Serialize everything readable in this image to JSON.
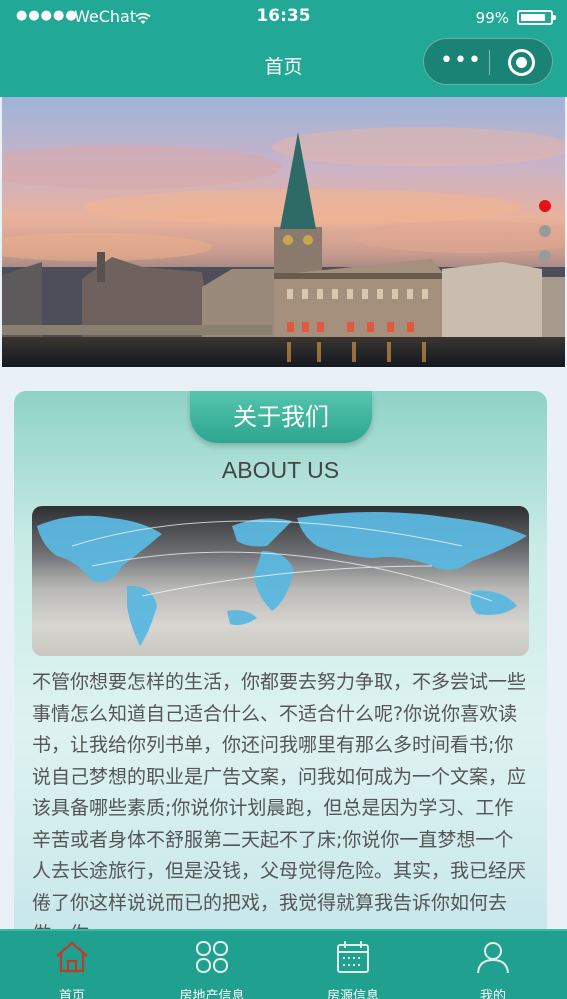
{
  "status_bar": {
    "signal": "●●●●●",
    "carrier": "WeChat",
    "time": "16:35",
    "battery": "99%"
  },
  "nav": {
    "title": "首页",
    "more_label": "•••"
  },
  "banner": {
    "slide_count": 3,
    "active_slide": 1
  },
  "about": {
    "title_cn": "关于我们",
    "title_en": "ABOUT US",
    "description": "不管你想要怎样的生活，你都要去努力争取，不多尝试一些事情怎么知道自己适合什么、不适合什么呢?你说你喜欢读书，让我给你列书单，你还问我哪里有那么多时间看书;你说自己梦想的职业是广告文案，问我如何成为一个文案，应该具备哪些素质;你说你计划晨跑，但总是因为学习、工作辛苦或者身体不舒服第二天起不了床;你说你一直梦想一个人去长途旅行，但是没钱，父母觉得危险。其实，我已经厌倦了你这样说说而已的把戏，我觉得就算我告诉你如何去做，你"
  },
  "tabbar": {
    "items": [
      {
        "label": "首页",
        "icon": "home-icon",
        "active": true
      },
      {
        "label": "房地产信息",
        "icon": "grid-icon",
        "active": false
      },
      {
        "label": "房源信息",
        "icon": "calendar-icon",
        "active": false
      },
      {
        "label": "我的",
        "icon": "user-icon",
        "active": false
      }
    ]
  },
  "colors": {
    "brand": "#22a896",
    "pager_active": "#e6101a",
    "pager_inactive": "#9a9a9a"
  }
}
